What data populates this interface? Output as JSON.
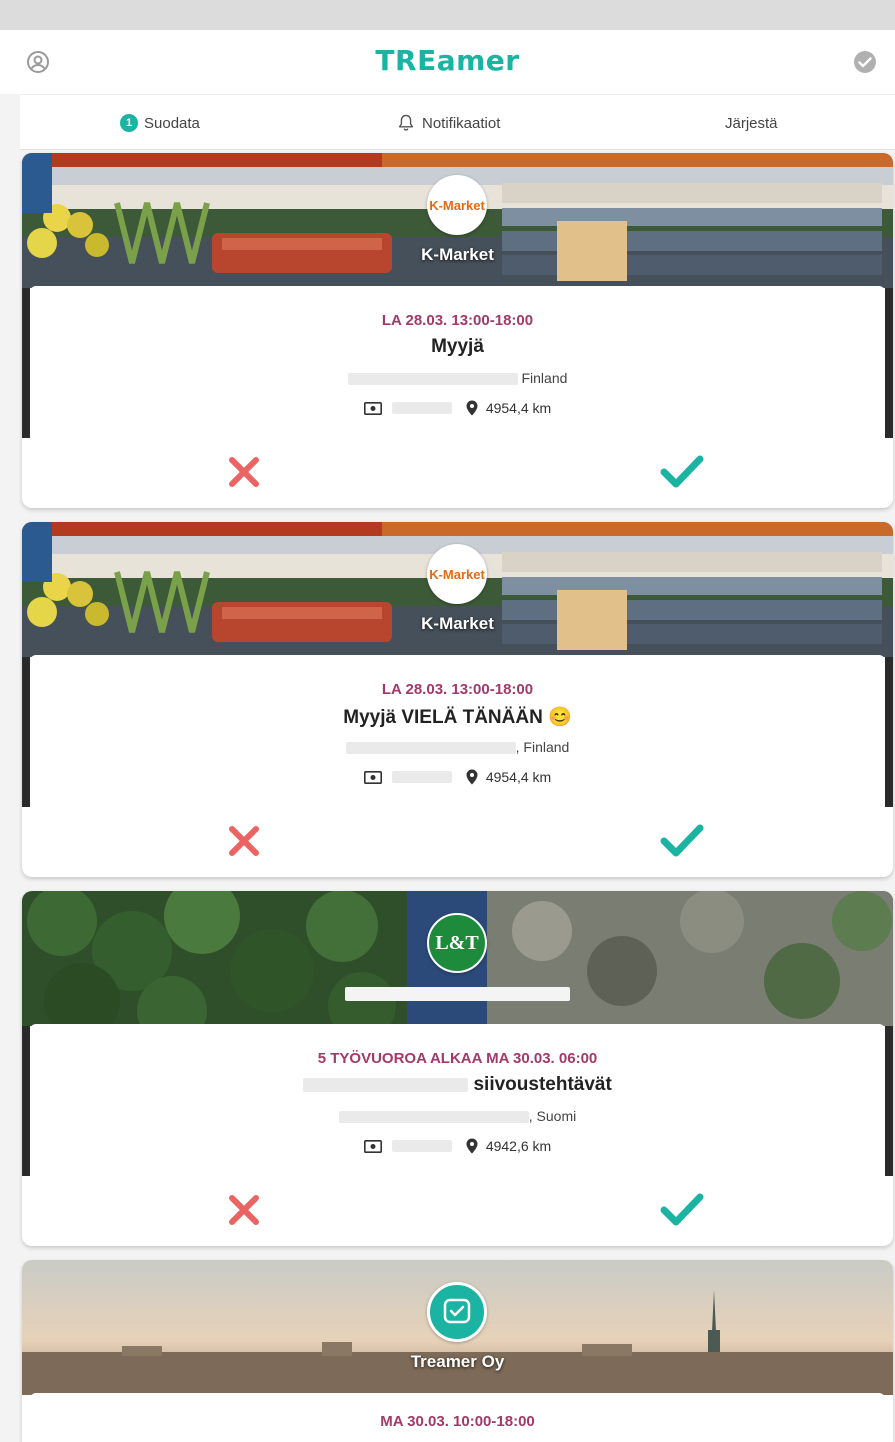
{
  "header": {
    "logo_text": "TREamer",
    "icons": {
      "left": "profile-icon",
      "right": "check-circle-icon"
    }
  },
  "filters": {
    "filter_badge": "1",
    "filter_label": "Suodata",
    "notifications_label": "Notifikaatiot",
    "sort_label": "Järjestä"
  },
  "colors": {
    "brand": "#1bb3a1",
    "date": "#a2396a",
    "reject": "#ea6464",
    "accept": "#1bb3a1"
  },
  "cards": [
    {
      "company": "K-Market",
      "logo_text": "K-Market",
      "when": "LA 28.03. 13:00-18:00",
      "title": "Myyjä",
      "address_visible": "Finland",
      "distance": "4954,4 km"
    },
    {
      "company": "K-Market",
      "logo_text": "K-Market",
      "when": "LA 28.03. 13:00-18:00",
      "title": "Myyjä VIELÄ TÄNÄÄN 😊",
      "address_visible": ", Finland",
      "distance": "4954,4 km"
    },
    {
      "company": "",
      "logo_text": "L&T",
      "when": "5 TYÖVUOROA ALKAA MA 30.03. 06:00",
      "title": "siivoustehtävät",
      "address_visible": ", Suomi",
      "distance": "4942,6 km"
    },
    {
      "company": "Treamer Oy",
      "when": "MA 30.03. 10:00-18:00"
    }
  ]
}
